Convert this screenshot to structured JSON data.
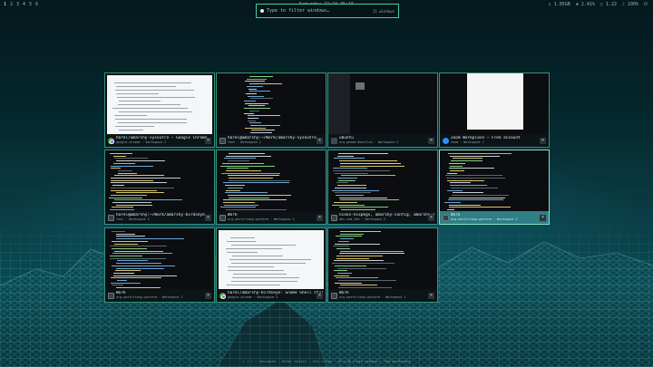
{
  "topbar": {
    "workspaces": [
      "1",
      "2",
      "3",
      "4",
      "5",
      "6"
    ],
    "active_workspace": "1",
    "clock": "Saturday 22:24  35:15",
    "status": [
      "▯ 1.05GB",
      "⊕ 2.41%",
      "▯ 1.22",
      "♪ 100%",
      "⏻"
    ]
  },
  "search": {
    "placeholder": "Type to filter windows…",
    "count": "11 windows"
  },
  "windows": [
    {
      "title": "harel/amarshy-sysoutro — Google Chrome",
      "app": "google-chrome",
      "workspace": "Workspace 2",
      "icon": "chrome-icon"
    },
    {
      "title": "harel@amarshy:~/Work/amarshy-sysoutro",
      "app": "foot",
      "workspace": "Workspace 2",
      "icon": "terminal-icon"
    },
    {
      "title": "ubuntu",
      "app": "org.gnome.Nautilus",
      "workspace": "Workspace 2",
      "icon": "files-icon"
    },
    {
      "title": "Zoom Workplace — Free account",
      "app": "zoom",
      "workspace": "Workspace 2",
      "icon": "zoom-icon"
    },
    {
      "title": "harel@amarshy:~/Work/amarshy-birdseye",
      "app": "foot",
      "workspace": "Workspace 2",
      "icon": "terminal-icon"
    },
    {
      "title": "Work",
      "app": "org.wezfurlong.wezterm",
      "workspace": "Workspace 2",
      "icon": "terminal-icon"
    },
    {
      "title": "nixos-nixpkgs, amarshy-config, amarshy-sysoutro — ...",
      "app": "dev.zed.Zed",
      "workspace": "Workspace 2",
      "icon": "zed-icon"
    },
    {
      "title": "Work",
      "app": "org.wezfurlong.wezterm",
      "workspace": "Workspace 2",
      "icon": "terminal-icon"
    },
    {
      "title": "Work",
      "app": "org.wezfurlong.wezterm",
      "workspace": "Workspace 1",
      "icon": "terminal-icon"
    },
    {
      "title": "harel/amarshy-birdseye: Gnome Shell style birds...",
      "app": "google-chrome",
      "workspace": "Workspace 2",
      "icon": "chrome-icon"
    },
    {
      "title": "Work",
      "app": "org.wezfurlong.wezterm",
      "workspace": "Workspace 1",
      "icon": "terminal-icon"
    }
  ],
  "selected_window": 7,
  "close_label": "×",
  "hint": "↑ ↓ ← → navigate · Enter select · Esc close · Ctrl+W close window · Tab workspace"
}
